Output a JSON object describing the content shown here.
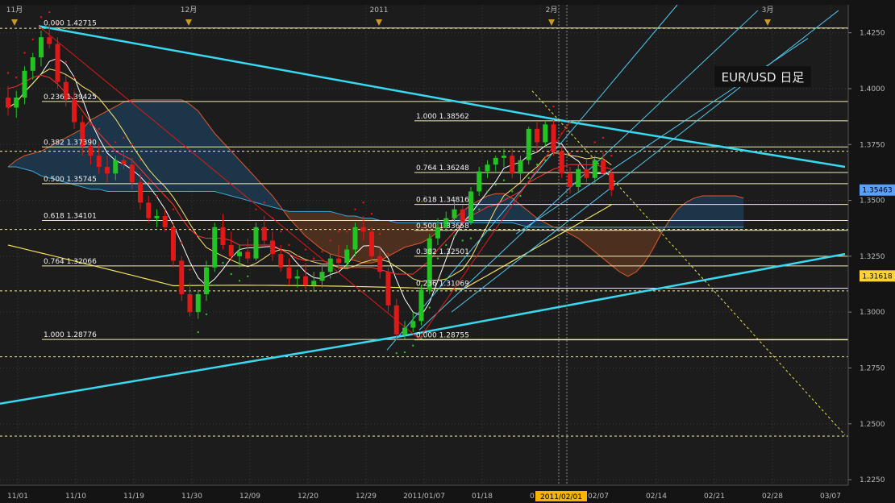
{
  "title": "EUR/USD 日足",
  "colors": {
    "background": "#1c1c1c",
    "grid": "#3a3a3a",
    "bull": "#22c322",
    "bear": "#e01818",
    "fib": "#f2eeb4",
    "trend": "#38d9f0",
    "price_tag": "#5aa0ff",
    "price_tag2": "#ffd23a",
    "kumo_bear": "#5a3420",
    "kumo_bull": "#1e3c55",
    "crosshair_label": "#f7b500"
  },
  "chart_data": {
    "type": "candlestick",
    "symbol": "EUR/USD",
    "timeframe": "日足",
    "ylim": [
      1.2225,
      1.4375
    ],
    "yticks": [
      1.425,
      1.4,
      1.375,
      1.35,
      1.325,
      1.3,
      1.275,
      1.25,
      1.225
    ],
    "ytick_labels": [
      "1.4250",
      "1.4000",
      "1.3750",
      "1.3500",
      "1.3250",
      "1.3000",
      "1.2750",
      "1.2500",
      "1.2250"
    ],
    "xticks": [
      "11/01",
      "11/10",
      "11/19",
      "11/30",
      "12/09",
      "12/20",
      "12/29",
      "2011/01/07",
      "01/18",
      "01/27",
      "02/07",
      "02/14",
      "02/21",
      "02/28",
      "03/07"
    ],
    "month_markers": [
      "11月",
      "12月",
      "2011",
      "2月",
      "3月"
    ],
    "crosshair_date": "2011/02/01",
    "price_labels": [
      {
        "label": "1.35463",
        "value": 1.35463
      },
      {
        "label": "1.31618",
        "value": 1.31618
      }
    ],
    "ohlc": [
      [
        1.396,
        1.401,
        1.388,
        1.3915
      ],
      [
        1.3915,
        1.399,
        1.387,
        1.396
      ],
      [
        1.396,
        1.41,
        1.393,
        1.408
      ],
      [
        1.408,
        1.416,
        1.404,
        1.414
      ],
      [
        1.414,
        1.426,
        1.41,
        1.423
      ],
      [
        1.423,
        1.4282,
        1.418,
        1.42
      ],
      [
        1.42,
        1.423,
        1.4,
        1.403
      ],
      [
        1.403,
        1.406,
        1.392,
        1.395
      ],
      [
        1.395,
        1.399,
        1.382,
        1.385
      ],
      [
        1.385,
        1.388,
        1.37,
        1.374
      ],
      [
        1.374,
        1.378,
        1.366,
        1.37
      ],
      [
        1.37,
        1.376,
        1.362,
        1.365
      ],
      [
        1.365,
        1.37,
        1.358,
        1.362
      ],
      [
        1.362,
        1.37,
        1.359,
        1.368
      ],
      [
        1.368,
        1.372,
        1.364,
        1.366
      ],
      [
        1.366,
        1.369,
        1.355,
        1.358
      ],
      [
        1.358,
        1.362,
        1.346,
        1.349
      ],
      [
        1.349,
        1.352,
        1.34,
        1.342
      ],
      [
        1.342,
        1.346,
        1.338,
        1.343
      ],
      [
        1.343,
        1.346,
        1.336,
        1.338
      ],
      [
        1.338,
        1.34,
        1.32,
        1.323
      ],
      [
        1.323,
        1.325,
        1.305,
        1.308
      ],
      [
        1.308,
        1.313,
        1.298,
        1.3
      ],
      [
        1.3,
        1.31,
        1.297,
        1.308
      ],
      [
        1.308,
        1.323,
        1.305,
        1.32
      ],
      [
        1.32,
        1.34,
        1.318,
        1.338
      ],
      [
        1.338,
        1.344,
        1.328,
        1.33
      ],
      [
        1.33,
        1.336,
        1.323,
        1.325
      ],
      [
        1.325,
        1.33,
        1.32,
        1.327
      ],
      [
        1.327,
        1.333,
        1.322,
        1.324
      ],
      [
        1.324,
        1.34,
        1.323,
        1.338
      ],
      [
        1.338,
        1.343,
        1.33,
        1.332
      ],
      [
        1.332,
        1.336,
        1.323,
        1.326
      ],
      [
        1.326,
        1.33,
        1.318,
        1.32
      ],
      [
        1.32,
        1.324,
        1.312,
        1.315
      ],
      [
        1.315,
        1.319,
        1.311,
        1.316
      ],
      [
        1.316,
        1.322,
        1.31,
        1.312
      ],
      [
        1.312,
        1.318,
        1.309,
        1.314
      ],
      [
        1.314,
        1.321,
        1.311,
        1.318
      ],
      [
        1.318,
        1.326,
        1.315,
        1.324
      ],
      [
        1.324,
        1.33,
        1.319,
        1.322
      ],
      [
        1.322,
        1.33,
        1.32,
        1.328
      ],
      [
        1.328,
        1.34,
        1.325,
        1.338
      ],
      [
        1.338,
        1.343,
        1.332,
        1.336
      ],
      [
        1.336,
        1.338,
        1.323,
        1.325
      ],
      [
        1.325,
        1.329,
        1.315,
        1.318
      ],
      [
        1.318,
        1.32,
        1.3,
        1.303
      ],
      [
        1.303,
        1.306,
        1.2876,
        1.29
      ],
      [
        1.29,
        1.296,
        1.288,
        1.293
      ],
      [
        1.293,
        1.3,
        1.291,
        1.296
      ],
      [
        1.296,
        1.312,
        1.294,
        1.31
      ],
      [
        1.31,
        1.335,
        1.308,
        1.333
      ],
      [
        1.333,
        1.342,
        1.33,
        1.338
      ],
      [
        1.338,
        1.345,
        1.336,
        1.342
      ],
      [
        1.342,
        1.35,
        1.34,
        1.346
      ],
      [
        1.346,
        1.348,
        1.338,
        1.34
      ],
      [
        1.34,
        1.356,
        1.339,
        1.354
      ],
      [
        1.354,
        1.365,
        1.352,
        1.363
      ],
      [
        1.363,
        1.368,
        1.36,
        1.366
      ],
      [
        1.366,
        1.37,
        1.363,
        1.369
      ],
      [
        1.369,
        1.373,
        1.365,
        1.37
      ],
      [
        1.37,
        1.373,
        1.36,
        1.362
      ],
      [
        1.362,
        1.37,
        1.358,
        1.368
      ],
      [
        1.368,
        1.383,
        1.366,
        1.382
      ],
      [
        1.382,
        1.385,
        1.372,
        1.376
      ],
      [
        1.376,
        1.3856,
        1.374,
        1.384
      ],
      [
        1.384,
        1.386,
        1.37,
        1.372
      ],
      [
        1.372,
        1.374,
        1.36,
        1.362
      ],
      [
        1.362,
        1.365,
        1.353,
        1.356
      ],
      [
        1.356,
        1.366,
        1.354,
        1.364
      ],
      [
        1.364,
        1.368,
        1.358,
        1.36
      ],
      [
        1.36,
        1.37,
        1.357,
        1.368
      ],
      [
        1.368,
        1.372,
        1.361,
        1.362
      ],
      [
        1.362,
        1.364,
        1.352,
        1.3546
      ]
    ],
    "kijun": [
      1.4,
      1.401,
      1.403,
      1.405,
      1.406,
      1.405,
      1.402,
      1.398,
      1.395,
      1.39,
      1.385,
      1.38,
      1.376,
      1.372,
      1.37,
      1.368,
      1.364,
      1.36,
      1.356,
      1.352,
      1.348,
      1.342,
      1.337,
      1.334,
      1.333,
      1.333,
      1.333,
      1.332,
      1.33,
      1.33,
      1.33,
      1.33,
      1.33,
      1.328,
      1.326,
      1.324,
      1.323,
      1.323,
      1.323,
      1.322,
      1.32,
      1.32,
      1.32,
      1.32,
      1.32,
      1.319,
      1.318,
      1.317,
      1.317,
      1.317,
      1.32,
      1.323,
      1.328,
      1.332,
      1.336,
      1.34,
      1.343,
      1.345,
      1.347,
      1.348,
      1.35,
      1.352,
      1.354,
      1.358,
      1.36,
      1.362,
      1.364,
      1.365,
      1.366,
      1.366,
      1.366,
      1.366,
      1.365,
      1.364
    ],
    "senkou_a": [
      1.365,
      1.368,
      1.37,
      1.371,
      1.372,
      1.374,
      1.376,
      1.378,
      1.38,
      1.382,
      1.386,
      1.388,
      1.39,
      1.392,
      1.394,
      1.395,
      1.395,
      1.395,
      1.395,
      1.395,
      1.395,
      1.395,
      1.393,
      1.39,
      1.385,
      1.38,
      1.376,
      1.372,
      1.368,
      1.364,
      1.36,
      1.356,
      1.352,
      1.347,
      1.342,
      1.338,
      1.334,
      1.331,
      1.328,
      1.326,
      1.325,
      1.324,
      1.323,
      1.322,
      1.322,
      1.323,
      1.325,
      1.327,
      1.329,
      1.33,
      1.331,
      1.333,
      1.336,
      1.339,
      1.342,
      1.345,
      1.348,
      1.35,
      1.352,
      1.353,
      1.353,
      1.351,
      1.348,
      1.345,
      1.342,
      1.34,
      1.338,
      1.337,
      1.335,
      1.333,
      1.33,
      1.327,
      1.324,
      1.321,
      1.318,
      1.316,
      1.318,
      1.322,
      1.328,
      1.335,
      1.341,
      1.346,
      1.349,
      1.351,
      1.352,
      1.352,
      1.352,
      1.352,
      1.352,
      1.351
    ],
    "senkou_b": [
      1.365,
      1.365,
      1.364,
      1.363,
      1.361,
      1.36,
      1.359,
      1.358,
      1.357,
      1.356,
      1.355,
      1.355,
      1.354,
      1.354,
      1.354,
      1.354,
      1.354,
      1.354,
      1.354,
      1.354,
      1.354,
      1.354,
      1.354,
      1.354,
      1.354,
      1.354,
      1.353,
      1.352,
      1.351,
      1.35,
      1.349,
      1.348,
      1.347,
      1.346,
      1.345,
      1.345,
      1.345,
      1.345,
      1.345,
      1.345,
      1.344,
      1.343,
      1.343,
      1.342,
      1.342,
      1.341,
      1.341,
      1.34,
      1.34,
      1.34,
      1.34,
      1.34,
      1.34,
      1.34,
      1.34,
      1.34,
      1.34,
      1.34,
      1.34,
      1.34,
      1.34,
      1.34,
      1.339,
      1.338,
      1.338,
      1.338,
      1.338,
      1.338,
      1.338,
      1.338,
      1.338,
      1.338,
      1.338,
      1.338,
      1.338,
      1.338,
      1.338,
      1.338,
      1.338,
      1.338,
      1.338,
      1.338,
      1.338,
      1.338,
      1.338,
      1.338,
      1.338,
      1.338,
      1.338,
      1.338
    ],
    "fib_left": {
      "levels": [
        {
          "label": "0.000 1.42715",
          "value": 1.42715
        },
        {
          "label": "0.236 1.39425",
          "value": 1.39425
        },
        {
          "label": "0.382 1.37390",
          "value": 1.3739
        },
        {
          "label": "0.500 1.35745",
          "value": 1.35745
        },
        {
          "label": "0.618 1.34101",
          "value": 1.34101
        },
        {
          "label": "0.764 1.32066",
          "value": 1.32066
        },
        {
          "label": "1.000 1.28776",
          "value": 1.28776
        }
      ]
    },
    "fib_right": {
      "levels": [
        {
          "label": "1.000 1.38562",
          "value": 1.38562
        },
        {
          "label": "0.764 1.36248",
          "value": 1.36248
        },
        {
          "label": "0.618 1.34816",
          "value": 1.34816
        },
        {
          "label": "0.500 1.33658",
          "value": 1.33658
        },
        {
          "label": "0.382 1.32501",
          "value": 1.32501
        },
        {
          "label": "0.236 1.31069",
          "value": 1.31069
        },
        {
          "label": "0.000 1.28755",
          "value": 1.28755
        }
      ]
    },
    "dashed_levels": [
      1.427,
      1.372,
      1.337,
      1.3095,
      1.28,
      1.2445
    ]
  }
}
